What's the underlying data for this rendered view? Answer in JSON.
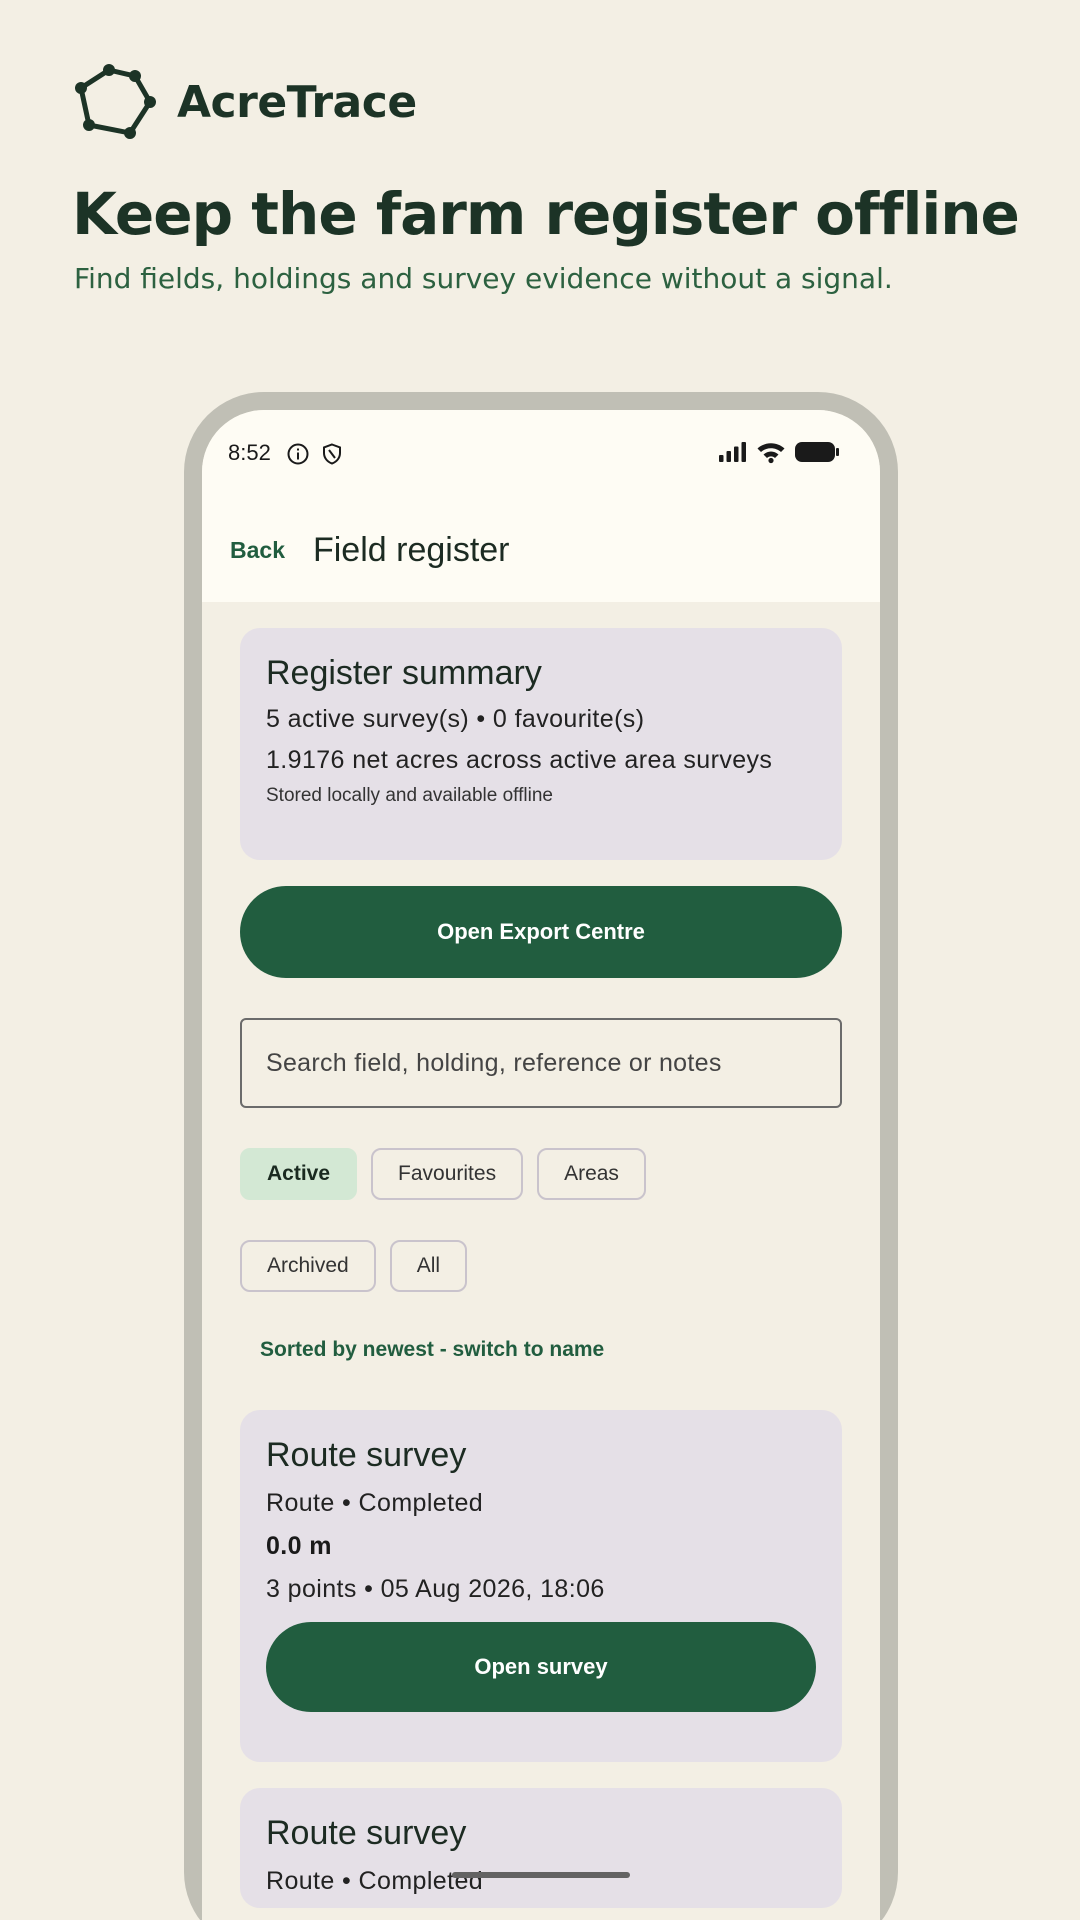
{
  "brand": {
    "name": "AcreTrace",
    "icon": "polygon-survey-icon"
  },
  "hero": {
    "title": "Keep the farm register offline",
    "subtitle": "Find fields, holdings and survey evidence without a signal."
  },
  "status_bar": {
    "time": "8:52",
    "icons_left": [
      "info-icon",
      "shield-icon"
    ],
    "icons_right": [
      "signal-icon",
      "wifi-icon",
      "battery-icon"
    ]
  },
  "appbar": {
    "back_label": "Back",
    "title": "Field register"
  },
  "summary": {
    "title": "Register summary",
    "counts": "5 active survey(s) • 0 favourite(s)",
    "acres": "1.9176 net acres across active area surveys",
    "note": "Stored locally and available offline"
  },
  "export_button": "Open Export Centre",
  "search": {
    "placeholder": "Search field, holding, reference or notes",
    "value": ""
  },
  "filters": [
    {
      "label": "Active",
      "selected": true
    },
    {
      "label": "Favourites",
      "selected": false
    },
    {
      "label": "Areas",
      "selected": false
    },
    {
      "label": "Archived",
      "selected": false
    },
    {
      "label": "All",
      "selected": false
    }
  ],
  "sort_label": "Sorted by newest - switch to name",
  "surveys": [
    {
      "title": "Route survey",
      "meta": "Route • Completed",
      "metric": "0.0 m",
      "details": "3 points • 05 Aug 2026, 18:06",
      "action": "Open survey"
    },
    {
      "title": "Route survey",
      "meta": "Route • Completed"
    }
  ],
  "colors": {
    "page_background": "#f3efe4",
    "primary": "#215d3f",
    "card": "#e5e0e7",
    "chip_selected": "#d3e8d4",
    "phone_frame": "#c0bfb5"
  }
}
